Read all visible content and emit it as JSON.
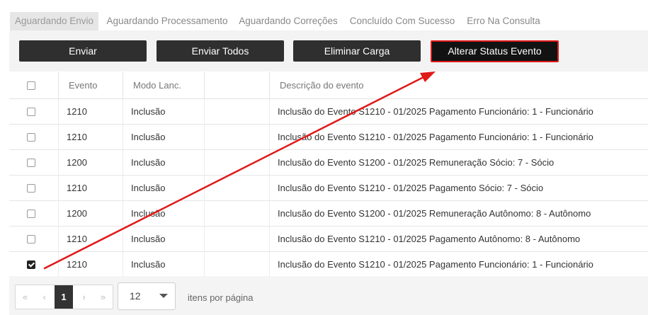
{
  "tabs": [
    {
      "label": "Aguardando Envio",
      "active": true
    },
    {
      "label": "Aguardando Processamento",
      "active": false
    },
    {
      "label": "Aguardando Correções",
      "active": false
    },
    {
      "label": "Concluído Com Sucesso",
      "active": false
    },
    {
      "label": "Erro Na Consulta",
      "active": false
    }
  ],
  "toolbar": {
    "enviar": "Enviar",
    "enviar_todos": "Enviar Todos",
    "eliminar_carga": "Eliminar Carga",
    "alterar_status": "Alterar Status Evento"
  },
  "table": {
    "headers": [
      "Evento",
      "Modo Lanc.",
      "",
      "Descrição do evento"
    ],
    "rows": [
      {
        "checked": false,
        "evento": "1210",
        "modo": "Inclusão",
        "descricao": "Inclusão do Evento S1210 - 01/2025 Pagamento Funcionário: 1 - Funcionário"
      },
      {
        "checked": false,
        "evento": "1210",
        "modo": "Inclusão",
        "descricao": "Inclusão do Evento S1210 - 01/2025 Pagamento Funcionário: 1 - Funcionário"
      },
      {
        "checked": false,
        "evento": "1200",
        "modo": "Inclusão",
        "descricao": "Inclusão do Evento S1200 - 01/2025 Remuneração Sócio: 7 - Sócio"
      },
      {
        "checked": false,
        "evento": "1210",
        "modo": "Inclusão",
        "descricao": "Inclusão do Evento S1210 - 01/2025 Pagamento Sócio: 7 - Sócio"
      },
      {
        "checked": false,
        "evento": "1200",
        "modo": "Inclusão",
        "descricao": "Inclusão do Evento S1200 - 01/2025 Remuneração Autônomo: 8 - Autônomo"
      },
      {
        "checked": false,
        "evento": "1210",
        "modo": "Inclusão",
        "descricao": "Inclusão do Evento S1210 - 01/2025 Pagamento Autônomo: 8 - Autônomo"
      },
      {
        "checked": true,
        "evento": "1210",
        "modo": "Inclusão",
        "descricao": "Inclusão do Evento S1210 - 01/2025 Pagamento Funcionário: 1 - Funcionário"
      }
    ]
  },
  "pagination": {
    "first": "«",
    "prev": "‹",
    "current_page": "1",
    "next": "›",
    "last": "»",
    "page_size": "12",
    "per_page_label": "itens por página"
  },
  "colors": {
    "button_bg": "#2f2f2f",
    "highlight": "#e01919",
    "annotation_arrow": "#e01919"
  }
}
